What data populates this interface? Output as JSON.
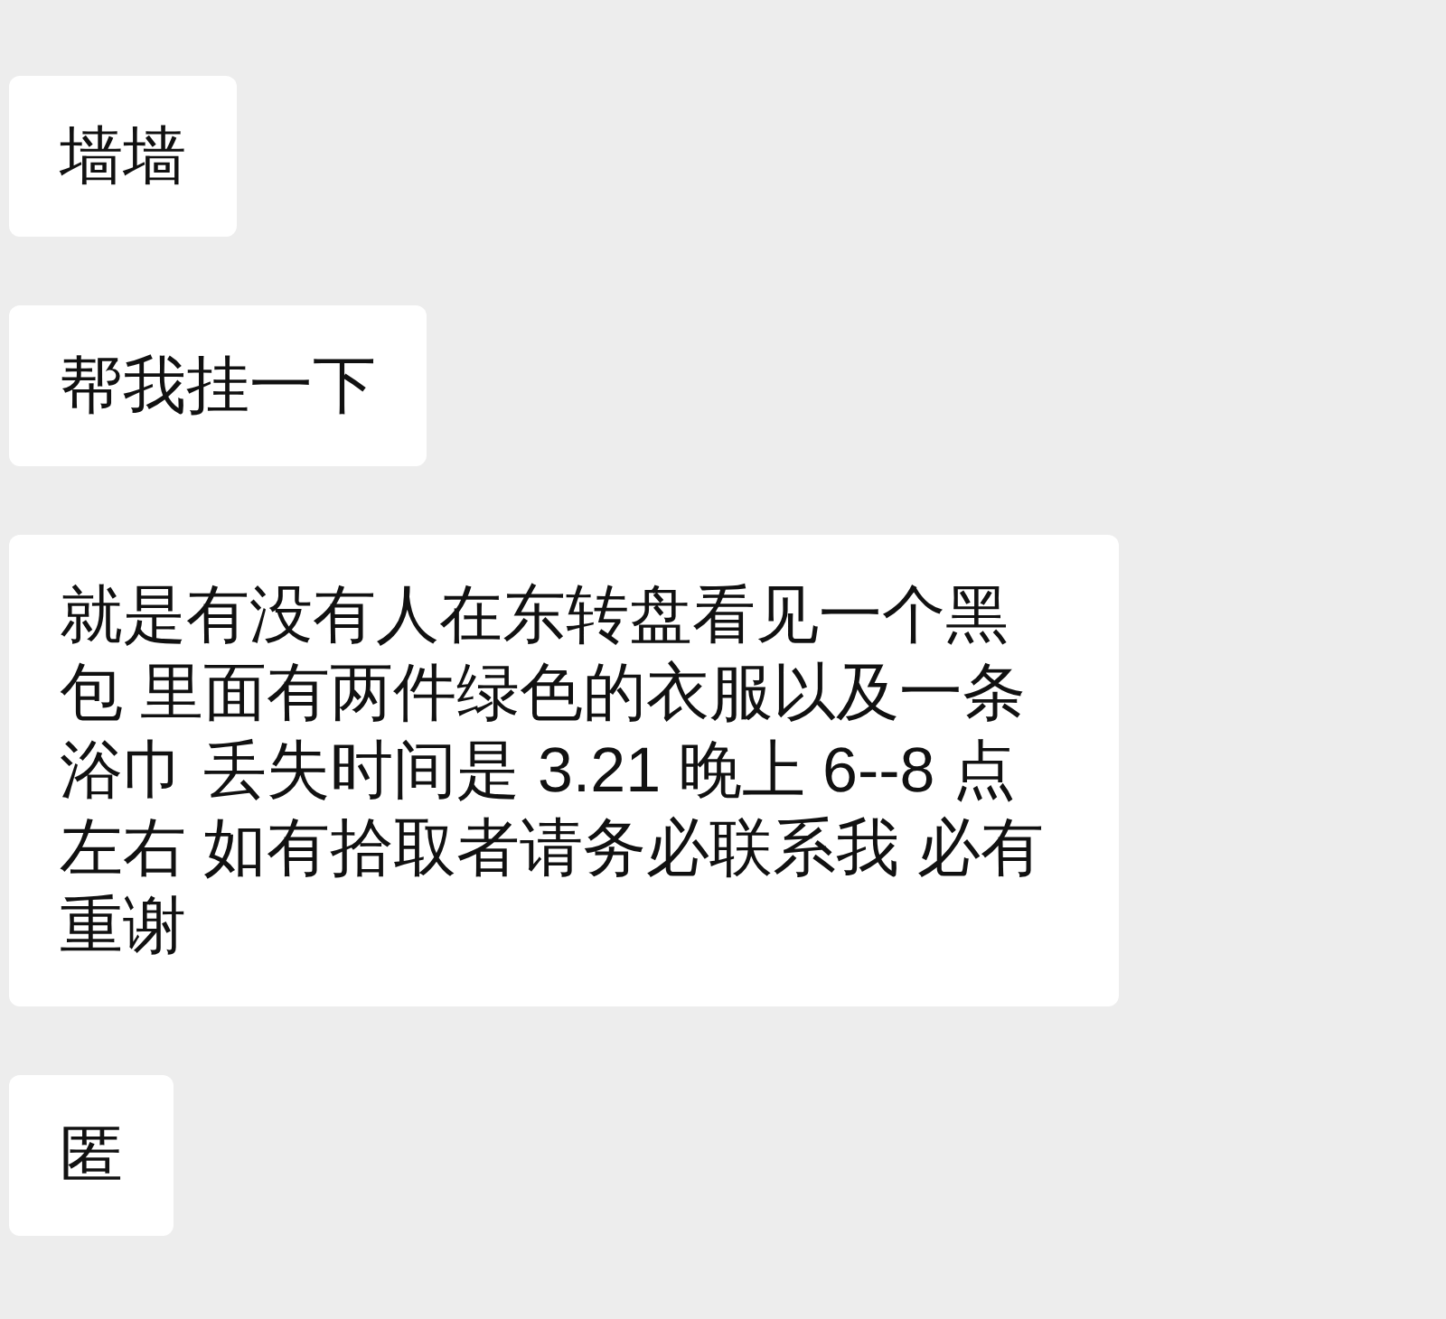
{
  "messages": [
    {
      "text": "墙墙"
    },
    {
      "text": "帮我挂一下"
    },
    {
      "text": "就是有没有人在东转盘看见一个黑包 里面有两件绿色的衣服以及一条浴巾 丢失时间是 3.21 晚上 6--8 点左右 如有拾取者请务必联系我 必有重谢"
    },
    {
      "text": "匿"
    }
  ]
}
